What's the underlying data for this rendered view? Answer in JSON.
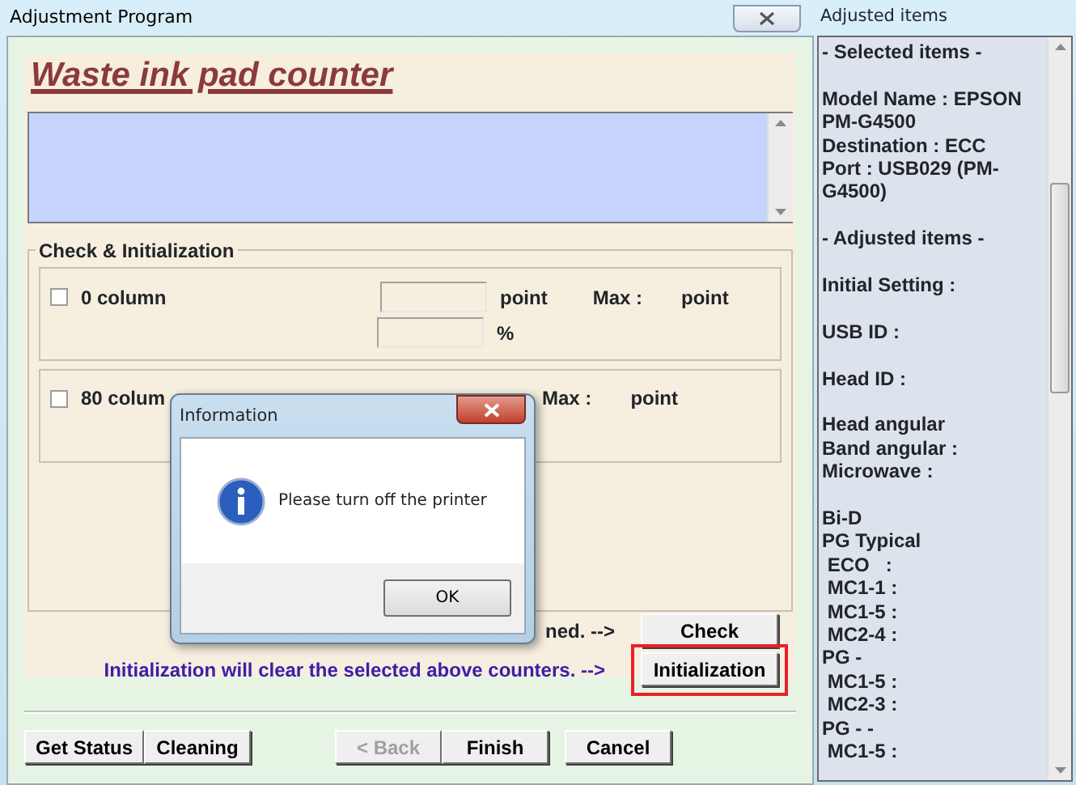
{
  "main_window": {
    "title": "Adjustment Program",
    "heading": "Waste ink pad counter",
    "group_title": "Check & Initialization",
    "counters": [
      {
        "label": "0 column",
        "checked": false,
        "unit": "point",
        "max_label": "Max :",
        "max_unit": "point",
        "percent": "%"
      },
      {
        "label": "80 colum",
        "checked": false,
        "max_label": "Max :",
        "max_unit": "point"
      }
    ],
    "check_note": "ned. -->",
    "check_button": "Check",
    "init_note": "Initialization will clear the selected above counters. -->",
    "init_button": {
      "label": "Initialization",
      "highlighted": true
    },
    "footer_buttons": [
      {
        "label": "Get Status",
        "disabled": false
      },
      {
        "label": "Cleaning",
        "disabled": false
      },
      {
        "label": "< Back",
        "disabled": true
      },
      {
        "label": "Finish",
        "disabled": false
      },
      {
        "label": "Cancel",
        "disabled": false
      }
    ]
  },
  "dialog": {
    "title": "Information",
    "message": "Please turn off the printer",
    "button": "OK"
  },
  "side_panel": {
    "title": "Adjusted items",
    "blocks": [
      [
        "- Selected items -"
      ],
      [
        "Model Name : EPSON PM-G4500",
        "Destination : ECC",
        "Port : USB029 (PM-G4500)"
      ],
      [
        "- Adjusted items -"
      ],
      [
        "Initial Setting :"
      ],
      [
        "USB ID :"
      ],
      [
        "Head ID :"
      ],
      [
        "Head angular",
        "Band angular :",
        "Microwave :"
      ],
      [
        "Bi-D",
        "PG Typical",
        " ECO   :",
        " MC1-1 :",
        " MC1-5 :",
        " MC2-4 :",
        "PG -",
        " MC1-5 :",
        " MC2-3 :",
        "PG - -",
        " MC1-5 :"
      ]
    ]
  }
}
